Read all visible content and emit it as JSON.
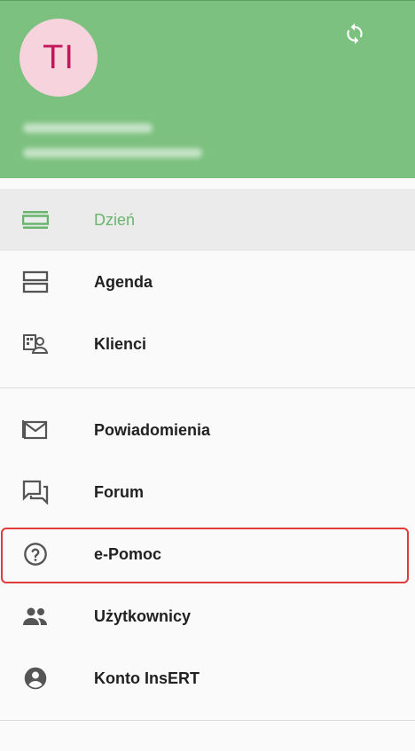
{
  "header": {
    "avatar_initials": "TI",
    "bg_color": "#7cc17f",
    "sync_icon": "sync-icon"
  },
  "menu": {
    "items": [
      {
        "label": "Dzień",
        "icon": "view-day-icon"
      },
      {
        "label": "Agenda",
        "icon": "view-agenda-icon"
      },
      {
        "label": "Klienci",
        "icon": "clients-icon"
      },
      {
        "label": "Powiadomienia",
        "icon": "mail-icon"
      },
      {
        "label": "Forum",
        "icon": "forum-icon"
      },
      {
        "label": "e-Pomoc",
        "icon": "help-icon"
      },
      {
        "label": "Użytkownicy",
        "icon": "people-icon"
      },
      {
        "label": "Konto InsERT",
        "icon": "account-icon"
      }
    ],
    "active_color": "#6ab56e",
    "highlight_color": "#e03a3a"
  }
}
